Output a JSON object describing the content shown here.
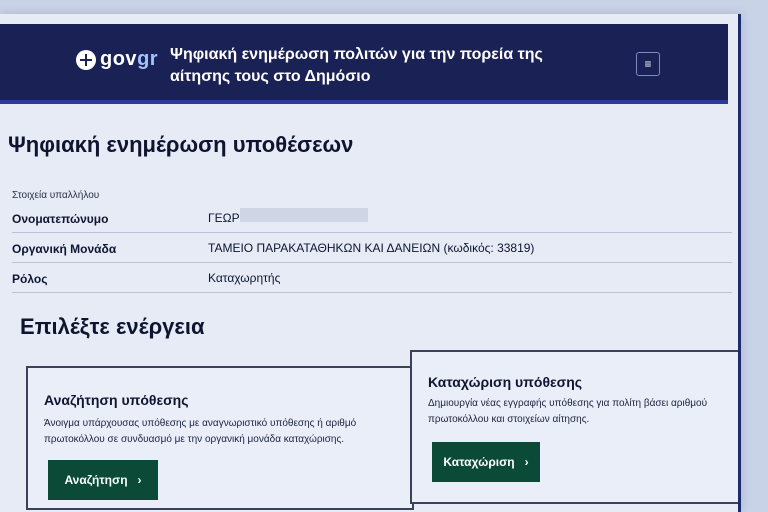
{
  "header": {
    "logo_text_a": "gov",
    "logo_text_b": "gr",
    "title": "Ψηφιακή ενημέρωση πολιτών για την πορεία της αίτησης τους στο Δημόσιο",
    "menu_icon": "hamburger-icon"
  },
  "page": {
    "title": "Ψηφιακή ενημέρωση υποθέσεων"
  },
  "employee": {
    "section_label": "Στοιχεία υπαλλήλου",
    "rows": [
      {
        "label": "Ονοματεπώνυμο",
        "value": "ΓΕΩΡ"
      },
      {
        "label": "Οργανική Μονάδα",
        "value": "ΤΑΜΕΙΟ ΠΑΡΑΚΑΤΑΘΗΚΩΝ ΚΑΙ ΔΑΝΕΙΩΝ (κωδικός: 33819)"
      },
      {
        "label": "Ρόλος",
        "value": "Καταχωρητής"
      }
    ]
  },
  "actions": {
    "title": "Επιλέξτε ενέργεια",
    "cards": [
      {
        "title": "Αναζήτηση υπόθεσης",
        "description": "Άνοιγμα υπάρχουσας υπόθεσης με αναγνωριστικό υπόθεσης ή αριθμό πρωτοκόλλου σε συνδυασμό με την οργανική μονάδα καταχώρισης.",
        "button": "Αναζήτηση",
        "button_icon": "chevron-right-icon"
      },
      {
        "title": "Καταχώριση υπόθεσης",
        "description": "Δημιουργία νέας εγγραφής υπόθεσης για πολίτη βάσει αριθμού πρωτοκόλλου και στοιχείων αίτησης.",
        "button": "Καταχώριση",
        "button_icon": "chevron-right-icon"
      }
    ]
  },
  "colors": {
    "header_bg": "#1a2155",
    "button_bg": "#0a4a36",
    "page_bg": "#e6ebf6"
  }
}
